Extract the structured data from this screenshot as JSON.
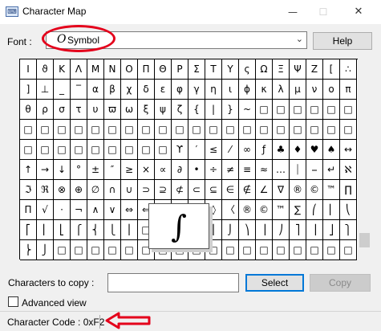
{
  "window": {
    "title": "Character Map",
    "app_icon": "⌨",
    "minimize": "—",
    "maximize": "☐",
    "close": "✕"
  },
  "font": {
    "label": "Font :",
    "icon": "O",
    "value": "Symbol",
    "arrow": "⌄"
  },
  "help_label": "Help",
  "grid": {
    "rows": [
      [
        "I",
        "ϑ",
        "K",
        "Λ",
        "M",
        "N",
        "O",
        "Π",
        "Θ",
        "P",
        "Σ",
        "T",
        "Υ",
        "ς",
        "Ω",
        "Ξ",
        "Ψ",
        "Z",
        "[",
        "∴"
      ],
      [
        "]",
        "⊥",
        "_",
        "‾",
        "α",
        "β",
        "χ",
        "δ",
        "ε",
        "φ",
        "γ",
        "η",
        "ι",
        "ϕ",
        "κ",
        "λ",
        "μ",
        "ν",
        "o",
        "π"
      ],
      [
        "θ",
        "ρ",
        "σ",
        "τ",
        "υ",
        "ϖ",
        "ω",
        "ξ",
        "ψ",
        "ζ",
        "{",
        "|",
        "}",
        "~",
        "□",
        "□",
        "□",
        "□",
        "□",
        "□"
      ],
      [
        "□",
        "□",
        "□",
        "□",
        "□",
        "□",
        "□",
        "□",
        "□",
        "□",
        "□",
        "□",
        "□",
        "□",
        "□",
        "□",
        "□",
        "□",
        "□",
        "□"
      ],
      [
        "□",
        "□",
        "□",
        "□",
        "□",
        "□",
        "□",
        "□",
        "□",
        "ϒ",
        "′",
        "≤",
        "⁄",
        "∞",
        "ƒ",
        "♣",
        "♦",
        "♥",
        "♠",
        "↔"
      ],
      [
        "↑",
        "→",
        "↓",
        "°",
        "±",
        "″",
        "≥",
        "×",
        "∝",
        "∂",
        "•",
        "÷",
        "≠",
        "≡",
        "≈",
        "…",
        "⏐",
        "⎯",
        "↵",
        "ℵ"
      ],
      [
        "ℑ",
        "ℜ",
        "⊗",
        "⊕",
        "∅",
        "∩",
        "∪",
        "⊃",
        "⊇",
        "⊄",
        "⊂",
        "⊆",
        "∈",
        "∉",
        "∠",
        "∇",
        "®",
        "©",
        "™",
        "∏"
      ],
      [
        "Π",
        "√",
        "⋅",
        "¬",
        "∧",
        "∨",
        "⇔",
        "⇐",
        "⇑",
        "⇒",
        "⇓",
        "◊",
        "〈",
        "®",
        "©",
        "™",
        "∑",
        "⎛",
        "⎜",
        "⎝"
      ],
      [
        "⎡",
        "⎢",
        "⎣",
        "⎧",
        "⎨",
        "⎩",
        "⎪",
        "□",
        "〉",
        "∫",
        "⌠",
        "⎮",
        "⌡",
        "⎞",
        "⎟",
        "⎠",
        "⎤",
        "⎥",
        "⎦",
        "⎫"
      ],
      [
        "⎬",
        "⎭",
        "□",
        "□",
        "□",
        "□",
        "□",
        "□",
        "□",
        "□",
        "□",
        "□",
        "□",
        "□",
        "□",
        "□",
        "□",
        "□",
        "□",
        "□"
      ]
    ],
    "zoomed_char": "∫"
  },
  "copy": {
    "label": "Characters to copy :",
    "value": "",
    "select_label": "Select",
    "copy_label": "Copy"
  },
  "advanced": {
    "label": "Advanced view",
    "checked": false
  },
  "status": {
    "text": "Character Code : 0xF2"
  },
  "colors": {
    "annotation": "#e4001b",
    "accent": "#0078d7"
  }
}
